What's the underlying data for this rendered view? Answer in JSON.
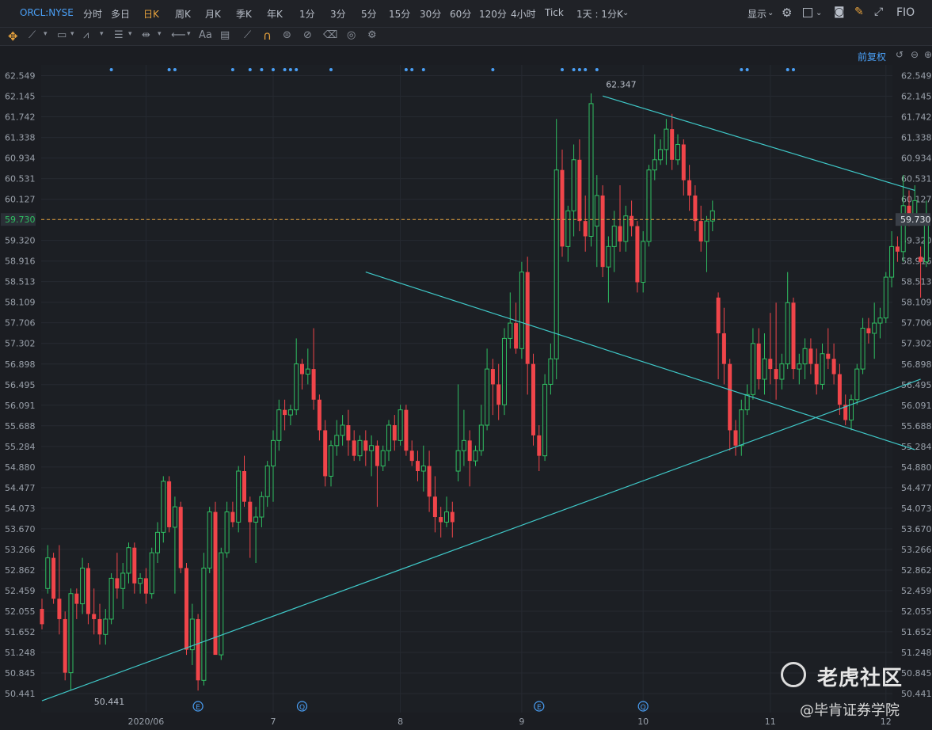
{
  "toolbar": {
    "ticker": "ORCL:NYSE",
    "periods": [
      "分时",
      "多日",
      "日K",
      "周K",
      "月K",
      "季K",
      "年K",
      "1分",
      "3分",
      "5分",
      "15分",
      "30分",
      "60分",
      "120分",
      "4小时",
      "Tick"
    ],
    "active_period": "日K",
    "range_select": "1天 : 1分K",
    "display_label": "显示",
    "fio_label": "FIO"
  },
  "drawing_tools": [
    "move",
    "line",
    "shape",
    "pattern",
    "fib",
    "measure",
    "arrow",
    "text",
    "comment",
    "ruler",
    "magnet",
    "lock",
    "hide",
    "delete",
    "compare",
    "settings"
  ],
  "text_tool_label": "Aa",
  "adjust_label": "前复权",
  "watermark": {
    "brand": "老虎社区",
    "account": "@毕肯证券学院"
  },
  "chart_data": {
    "type": "candlestick",
    "symbol": "ORCL:NYSE",
    "y_ticks": [
      62.549,
      62.145,
      61.742,
      61.338,
      60.934,
      60.531,
      60.127,
      59.73,
      59.32,
      58.916,
      58.513,
      58.109,
      57.706,
      57.302,
      56.898,
      56.495,
      56.091,
      55.688,
      55.284,
      54.88,
      54.477,
      54.073,
      53.67,
      53.266,
      52.862,
      52.459,
      52.055,
      51.652,
      51.248,
      50.845,
      50.441
    ],
    "y_tick_labels": [
      "62.549",
      "62.145",
      "61.742",
      "61.338",
      "60.934",
      "60.531",
      "60.127",
      "59.730",
      "59.320",
      "58.916",
      "58.513",
      "58.109",
      "57.706",
      "57.302",
      "56.898",
      "56.495",
      "56.091",
      "55.688",
      "55.284",
      "54.880",
      "54.477",
      "54.073",
      "53.670",
      "53.266",
      "52.862",
      "52.459",
      "52.055",
      "51.652",
      "51.248",
      "50.845",
      "50.441"
    ],
    "ylim": [
      50.24,
      62.75
    ],
    "x_labels": [
      {
        "label": "2020/06",
        "index": 18
      },
      {
        "label": "7",
        "index": 40
      },
      {
        "label": "8",
        "index": 62
      },
      {
        "label": "9",
        "index": 83
      },
      {
        "label": "10",
        "index": 104
      },
      {
        "label": "11",
        "index": 126
      },
      {
        "label": "12",
        "index": 146
      }
    ],
    "current_price": 59.73,
    "current_price_label": "59.730",
    "max_label": {
      "value": 62.347,
      "text": "62.347",
      "index": 94
    },
    "min_label": {
      "value": 50.441,
      "text": "50.441",
      "index": 6
    },
    "trendlines": [
      {
        "from": [
          0,
          50.3
        ],
        "to": [
          152,
          56.6
        ]
      },
      {
        "from": [
          97,
          62.15
        ],
        "to": [
          151,
          60.3
        ]
      },
      {
        "from": [
          56,
          58.7
        ],
        "to": [
          151,
          55.22
        ]
      }
    ],
    "event_markers": [
      {
        "index": 27,
        "label": "E"
      },
      {
        "index": 45,
        "label": "Q"
      },
      {
        "index": 86,
        "label": "E"
      },
      {
        "index": 104,
        "label": "Q"
      }
    ],
    "candles": [
      [
        52.1,
        52.3,
        51.7,
        51.8
      ],
      [
        52.5,
        53.35,
        52.4,
        53.1
      ],
      [
        53.1,
        53.2,
        52.2,
        52.3
      ],
      [
        52.3,
        53.35,
        51.6,
        51.9
      ],
      [
        51.9,
        52.05,
        50.7,
        50.85
      ],
      [
        50.85,
        52.5,
        50.5,
        52.4
      ],
      [
        52.4,
        52.5,
        51.9,
        52.2
      ],
      [
        52.2,
        53.1,
        52.0,
        52.9
      ],
      [
        52.9,
        53.0,
        51.8,
        52.0
      ],
      [
        52.0,
        52.5,
        51.6,
        51.9
      ],
      [
        51.9,
        52.2,
        51.4,
        51.6
      ],
      [
        51.6,
        52.1,
        51.4,
        51.9
      ],
      [
        51.9,
        52.8,
        51.8,
        52.7
      ],
      [
        52.7,
        53.2,
        52.3,
        52.5
      ],
      [
        52.5,
        53.0,
        52.1,
        52.8
      ],
      [
        52.8,
        53.4,
        52.6,
        53.3
      ],
      [
        53.3,
        53.4,
        52.4,
        52.6
      ],
      [
        52.6,
        52.8,
        52.4,
        52.7
      ],
      [
        52.7,
        52.9,
        52.2,
        52.4
      ],
      [
        52.4,
        53.3,
        52.3,
        53.2
      ],
      [
        53.2,
        53.8,
        53.0,
        53.6
      ],
      [
        53.6,
        54.7,
        53.4,
        54.6
      ],
      [
        54.6,
        54.7,
        53.6,
        53.7
      ],
      [
        53.7,
        54.3,
        52.4,
        54.1
      ],
      [
        54.1,
        54.2,
        52.8,
        52.9
      ],
      [
        52.9,
        53.0,
        51.2,
        51.3
      ],
      [
        51.3,
        52.2,
        51.0,
        51.9
      ],
      [
        51.9,
        52.0,
        50.5,
        50.7
      ],
      [
        50.7,
        53.2,
        50.6,
        52.9
      ],
      [
        52.9,
        54.1,
        52.8,
        54.0
      ],
      [
        54.0,
        54.2,
        51.3,
        51.2
      ],
      [
        51.2,
        53.3,
        51.1,
        53.2
      ],
      [
        53.2,
        54.2,
        53.1,
        54.0
      ],
      [
        54.0,
        54.2,
        53.7,
        53.8
      ],
      [
        53.8,
        54.9,
        53.6,
        54.8
      ],
      [
        54.8,
        55.1,
        54.1,
        54.2
      ],
      [
        54.2,
        54.3,
        53.1,
        53.8
      ],
      [
        53.8,
        54.1,
        53.0,
        53.9
      ],
      [
        53.9,
        54.4,
        53.7,
        54.3
      ],
      [
        54.3,
        55.0,
        54.1,
        54.9
      ],
      [
        54.9,
        55.6,
        54.2,
        55.4
      ],
      [
        55.4,
        56.2,
        55.2,
        56.0
      ],
      [
        56.0,
        56.2,
        55.6,
        55.9
      ],
      [
        55.9,
        56.1,
        55.7,
        56.0
      ],
      [
        56.0,
        57.4,
        55.9,
        56.9
      ],
      [
        56.9,
        57.0,
        56.4,
        56.7
      ],
      [
        56.7,
        57.2,
        56.5,
        56.8
      ],
      [
        56.8,
        57.6,
        56.0,
        56.2
      ],
      [
        56.2,
        56.3,
        55.4,
        55.6
      ],
      [
        55.6,
        55.8,
        54.5,
        54.7
      ],
      [
        54.7,
        55.4,
        54.5,
        55.3
      ],
      [
        55.3,
        55.8,
        55.1,
        55.5
      ],
      [
        55.5,
        55.9,
        55.3,
        55.7
      ],
      [
        55.7,
        56.0,
        55.1,
        55.4
      ],
      [
        55.4,
        55.6,
        55.0,
        55.1
      ],
      [
        55.1,
        55.5,
        55.0,
        55.4
      ],
      [
        55.4,
        55.6,
        54.9,
        55.2
      ],
      [
        55.2,
        55.5,
        54.7,
        55.3
      ],
      [
        55.3,
        55.4,
        54.1,
        54.9
      ],
      [
        54.9,
        55.3,
        54.8,
        55.2
      ],
      [
        55.2,
        55.8,
        55.0,
        55.7
      ],
      [
        55.7,
        55.9,
        55.2,
        55.4
      ],
      [
        55.4,
        56.1,
        55.3,
        56.0
      ],
      [
        56.0,
        56.1,
        55.1,
        55.2
      ],
      [
        55.2,
        55.4,
        54.9,
        55.0
      ],
      [
        55.0,
        55.2,
        54.6,
        54.8
      ],
      [
        54.8,
        55.3,
        54.4,
        54.9
      ],
      [
        54.9,
        55.2,
        54.0,
        54.3
      ],
      [
        54.3,
        54.7,
        53.6,
        53.9
      ],
      [
        53.9,
        54.1,
        53.5,
        53.8
      ],
      [
        53.8,
        54.3,
        53.7,
        54.0
      ],
      [
        54.0,
        54.2,
        53.5,
        53.8
      ],
      [
        54.8,
        56.5,
        54.6,
        55.2
      ],
      [
        55.2,
        56.0,
        54.9,
        55.4
      ],
      [
        55.4,
        55.6,
        54.5,
        55.0
      ],
      [
        55.0,
        55.3,
        54.9,
        55.2
      ],
      [
        55.2,
        56.1,
        55.1,
        55.7
      ],
      [
        55.7,
        57.2,
        55.6,
        56.8
      ],
      [
        56.8,
        57.0,
        55.9,
        56.5
      ],
      [
        56.5,
        56.9,
        55.8,
        56.1
      ],
      [
        56.1,
        57.6,
        55.9,
        57.4
      ],
      [
        57.4,
        58.3,
        57.2,
        57.7
      ],
      [
        57.7,
        58.1,
        57.1,
        57.2
      ],
      [
        57.2,
        58.9,
        57.0,
        58.7
      ],
      [
        58.7,
        59.0,
        56.3,
        56.9
      ],
      [
        56.9,
        57.1,
        55.3,
        55.5
      ],
      [
        55.5,
        55.7,
        54.8,
        55.1
      ],
      [
        55.1,
        56.7,
        55.0,
        56.5
      ],
      [
        56.5,
        57.3,
        56.3,
        57.0
      ],
      [
        57.0,
        61.7,
        56.6,
        60.7
      ],
      [
        60.7,
        61.1,
        59.0,
        59.2
      ],
      [
        59.2,
        60.0,
        58.9,
        59.9
      ],
      [
        59.9,
        61.2,
        59.4,
        60.9
      ],
      [
        60.9,
        61.3,
        59.5,
        59.7
      ],
      [
        59.7,
        60.2,
        59.1,
        59.4
      ],
      [
        59.4,
        62.2,
        59.2,
        62.0
      ],
      [
        59.6,
        60.6,
        58.8,
        60.2
      ],
      [
        60.2,
        60.4,
        58.6,
        58.8
      ],
      [
        58.8,
        59.4,
        58.1,
        59.2
      ],
      [
        59.2,
        59.9,
        58.7,
        59.6
      ],
      [
        59.6,
        60.4,
        59.1,
        59.3
      ],
      [
        59.3,
        60.0,
        59.1,
        59.8
      ],
      [
        59.8,
        60.1,
        59.4,
        59.6
      ],
      [
        59.6,
        59.7,
        58.3,
        58.5
      ],
      [
        58.5,
        59.5,
        58.3,
        59.3
      ],
      [
        59.3,
        60.8,
        59.2,
        60.7
      ],
      [
        60.7,
        61.4,
        60.5,
        60.9
      ],
      [
        60.9,
        61.3,
        60.8,
        61.1
      ],
      [
        61.1,
        61.7,
        60.8,
        61.5
      ],
      [
        61.5,
        61.8,
        60.7,
        60.9
      ],
      [
        60.9,
        61.4,
        60.8,
        61.2
      ],
      [
        61.2,
        61.3,
        60.2,
        60.5
      ],
      [
        60.5,
        60.8,
        59.9,
        60.2
      ],
      [
        60.2,
        60.4,
        59.5,
        59.7
      ],
      [
        59.7,
        60.0,
        59.1,
        59.3
      ],
      [
        59.3,
        59.8,
        58.7,
        59.7
      ],
      [
        59.7,
        60.1,
        59.5,
        59.9
      ],
      [
        58.2,
        58.3,
        56.6,
        57.5
      ],
      [
        57.5,
        58.0,
        56.5,
        56.9
      ],
      [
        56.9,
        57.0,
        55.2,
        55.6
      ],
      [
        55.6,
        55.8,
        55.1,
        55.3
      ],
      [
        55.3,
        56.2,
        55.1,
        56.0
      ],
      [
        56.0,
        56.5,
        55.9,
        56.3
      ],
      [
        56.3,
        57.6,
        56.2,
        57.3
      ],
      [
        57.3,
        57.6,
        56.4,
        56.6
      ],
      [
        56.6,
        57.5,
        56.3,
        57.0
      ],
      [
        57.0,
        57.9,
        56.5,
        56.8
      ],
      [
        56.8,
        58.1,
        56.2,
        56.6
      ],
      [
        56.6,
        57.1,
        56.4,
        56.9
      ],
      [
        56.9,
        58.7,
        56.8,
        58.1
      ],
      [
        58.1,
        58.2,
        56.6,
        56.8
      ],
      [
        56.8,
        57.1,
        56.5,
        56.9
      ],
      [
        56.9,
        57.4,
        56.6,
        57.2
      ],
      [
        57.2,
        57.4,
        56.7,
        56.9
      ],
      [
        56.9,
        57.2,
        56.3,
        56.5
      ],
      [
        56.5,
        57.3,
        56.4,
        57.1
      ],
      [
        57.1,
        57.6,
        56.8,
        57.0
      ],
      [
        57.0,
        57.3,
        56.5,
        56.7
      ],
      [
        56.7,
        56.9,
        55.9,
        56.1
      ],
      [
        56.1,
        56.3,
        55.7,
        55.8
      ],
      [
        55.8,
        56.3,
        55.6,
        56.2
      ],
      [
        56.2,
        56.9,
        56.1,
        56.8
      ],
      [
        56.8,
        57.8,
        56.7,
        57.6
      ],
      [
        57.6,
        57.8,
        57.3,
        57.5
      ],
      [
        57.5,
        58.1,
        57.0,
        57.7
      ],
      [
        57.7,
        58.0,
        57.4,
        57.8
      ],
      [
        57.8,
        58.7,
        57.7,
        58.6
      ],
      [
        58.6,
        59.5,
        58.4,
        59.2
      ],
      [
        59.2,
        59.4,
        58.9,
        59.1
      ],
      [
        59.1,
        60.6,
        58.9,
        60.0
      ],
      [
        60.0,
        60.3,
        59.6,
        59.8
      ],
      [
        59.8,
        60.4,
        59.7,
        60.1
      ],
      [
        59.0,
        59.2,
        58.2,
        58.9
      ],
      [
        58.9,
        60.1,
        58.8,
        59.7
      ]
    ]
  }
}
